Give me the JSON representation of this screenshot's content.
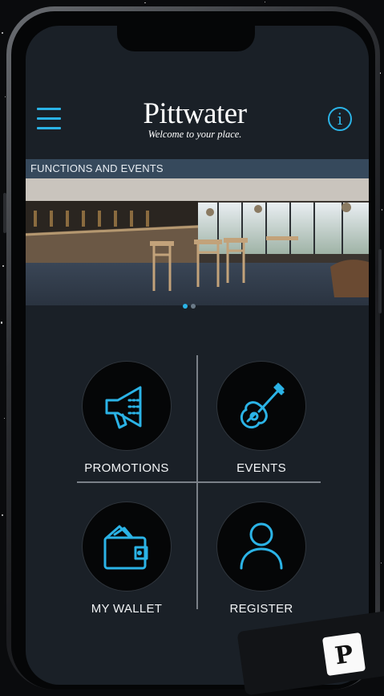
{
  "header": {
    "logo_word": "Pittwater",
    "logo_tagline": "Welcome to your place."
  },
  "section": {
    "title": "FUNCTIONS AND EVENTS"
  },
  "carousel": {
    "dot_count": 2,
    "active_index": 0
  },
  "tiles": [
    {
      "label": "PROMOTIONS",
      "icon": "megaphone-icon"
    },
    {
      "label": "EVENTS",
      "icon": "guitar-icon"
    },
    {
      "label": "MY WALLET",
      "icon": "wallet-icon"
    },
    {
      "label": "REGISTER",
      "icon": "user-icon"
    }
  ],
  "corner_badge": {
    "letter": "P"
  },
  "colors": {
    "accent": "#2bb3e6",
    "screen_bg": "#1a2027",
    "section_bar": "#36495c"
  }
}
